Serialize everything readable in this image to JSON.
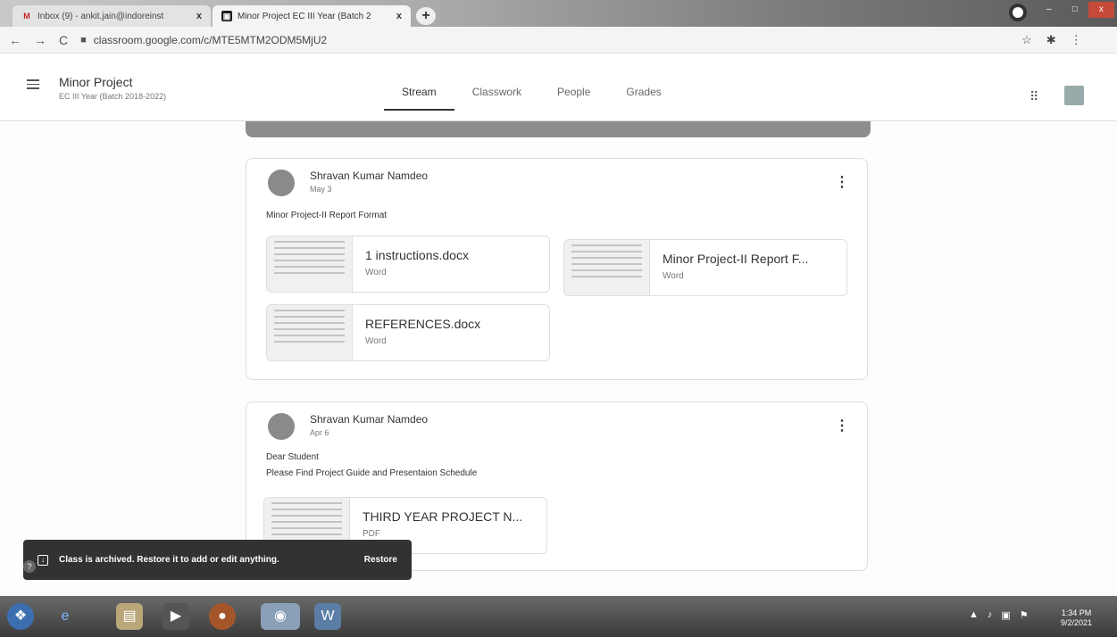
{
  "browser": {
    "tabs": [
      {
        "label": "Inbox (9) - ankit.jain@indoreinst",
        "favicon": "M",
        "active": false
      },
      {
        "label": "Minor Project EC III Year (Batch 2",
        "favicon": "▣",
        "active": true
      }
    ],
    "close_glyph": "x",
    "new_tab_glyph": "+",
    "url": "classroom.google.com/c/MTE5MTM2ODM5MjU2",
    "nav": {
      "back": "←",
      "forward": "→",
      "reload": "C"
    },
    "right_icons": {
      "star": "☆",
      "ext": "✱",
      "menu": "⋮"
    }
  },
  "header": {
    "class_title": "Minor Project",
    "class_subtitle": "EC III Year (Batch 2018-2022)",
    "tabs": [
      {
        "label": "Stream",
        "active": true
      },
      {
        "label": "Classwork",
        "active": false
      },
      {
        "label": "People",
        "active": false
      },
      {
        "label": "Grades",
        "active": false
      }
    ],
    "apps_glyph": "⠿"
  },
  "posts": [
    {
      "author": "Shravan Kumar Namdeo",
      "date": "May 3",
      "text_lines": [
        "Minor Project-II Report Format"
      ],
      "attachments": [
        {
          "name": "1 instructions.docx",
          "type": "Word"
        },
        {
          "name": "Minor Project-II Report F...",
          "type": "Word"
        },
        {
          "name": "REFERENCES.docx",
          "type": "Word"
        }
      ]
    },
    {
      "author": "Shravan Kumar Namdeo",
      "date": "Apr 6",
      "text_lines": [
        "Dear Student",
        "Please Find Project Guide and Presentaion Schedule"
      ],
      "attachments": [
        {
          "name": "THIRD YEAR PROJECT N...",
          "type": "PDF"
        }
      ]
    }
  ],
  "kebab_glyph": "⋮",
  "snackbar": {
    "message": "Class is archived. Restore it to add or edit anything.",
    "action": "Restore"
  },
  "help_glyph": "?",
  "taskbar": {
    "clock_time": "1:34 PM",
    "clock_date": "9/2/2021"
  }
}
